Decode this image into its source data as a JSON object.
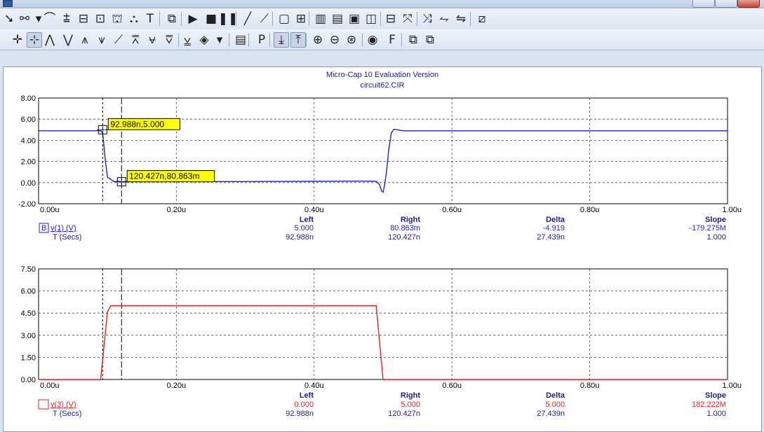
{
  "window": {
    "icons": [
      "app-icon",
      "minimize-icon",
      "maximize-icon",
      "close-icon"
    ]
  },
  "toolbar1": {
    "buttons": [
      {
        "name": "select-mode-icon",
        "glyph": "➘"
      },
      {
        "name": "component-mode-icon",
        "glyph": "⚯"
      },
      {
        "name": "component-dropdown-icon",
        "glyph": "▾"
      },
      {
        "name": "wire-mode-icon",
        "glyph": "⌒"
      },
      {
        "name": "bus-mode-icon",
        "glyph": "⩲"
      },
      {
        "name": "diagonal-wire-icon",
        "glyph": "⊟"
      },
      {
        "name": "flag-mode-icon",
        "glyph": "⊡"
      },
      {
        "name": "pin-mode-icon",
        "glyph": "⛫"
      },
      {
        "name": "info-mode-icon",
        "glyph": "⛬"
      },
      {
        "name": "text-mode-icon",
        "glyph": "T"
      },
      {
        "name": "properties-icon",
        "glyph": "⧉"
      },
      {
        "name": "run-icon",
        "glyph": "▶"
      },
      {
        "name": "stop-icon",
        "glyph": "■"
      },
      {
        "name": "pause-icon",
        "glyph": "❚❚"
      },
      {
        "name": "line-icon",
        "glyph": "╱"
      },
      {
        "name": "arrow-line-icon",
        "glyph": "⟋"
      },
      {
        "name": "rectangle-icon",
        "glyph": "▢"
      },
      {
        "name": "grid-icon",
        "glyph": "⊞"
      },
      {
        "name": "view-1-icon",
        "glyph": "▥"
      },
      {
        "name": "view-2-icon",
        "glyph": "▤"
      },
      {
        "name": "view-3-icon",
        "glyph": "▣"
      },
      {
        "name": "view-4-icon",
        "glyph": "◫"
      },
      {
        "name": "flip-x-icon",
        "glyph": "⊟"
      },
      {
        "name": "flip-y-icon",
        "glyph": "⤧"
      },
      {
        "name": "rotate-icon",
        "glyph": "⤨"
      },
      {
        "name": "mirror-icon",
        "glyph": "⥊"
      },
      {
        "name": "step-icon",
        "glyph": "⇋"
      },
      {
        "name": "plot-icon",
        "glyph": "⧄"
      }
    ]
  },
  "toolbar2": {
    "buttons": [
      {
        "name": "cursor-mode-icon",
        "glyph": "✛"
      },
      {
        "name": "data-cursor-icon",
        "glyph": "⊹"
      },
      {
        "name": "peak-icon",
        "glyph": "⋀"
      },
      {
        "name": "valley-icon",
        "glyph": "⋁"
      },
      {
        "name": "high-icon",
        "glyph": "⩚"
      },
      {
        "name": "low-icon",
        "glyph": "⩛"
      },
      {
        "name": "inflection-icon",
        "glyph": "⟋"
      },
      {
        "name": "global-high-icon",
        "glyph": "⩞"
      },
      {
        "name": "global-low-icon",
        "glyph": "⩝"
      },
      {
        "name": "top-icon",
        "glyph": "⩢"
      },
      {
        "name": "bottom-icon",
        "glyph": "⩣"
      },
      {
        "name": "palette-icon",
        "glyph": "◈"
      },
      {
        "name": "palette-dropdown-icon",
        "glyph": "▾"
      },
      {
        "name": "numeric-output-icon",
        "glyph": "▤"
      },
      {
        "name": "performance-icon",
        "glyph": "P"
      },
      {
        "name": "tag-horizontal-icon",
        "glyph": "⤓"
      },
      {
        "name": "tag-vertical-icon",
        "glyph": "⤒"
      },
      {
        "name": "zoom-in-icon",
        "glyph": "⊕"
      },
      {
        "name": "zoom-out-icon",
        "glyph": "⊖"
      },
      {
        "name": "zoom-fit-icon",
        "glyph": "⊛"
      },
      {
        "name": "animate-icon",
        "glyph": "◉"
      },
      {
        "name": "font-icon",
        "glyph": "F"
      },
      {
        "name": "copy-icon",
        "glyph": "⧉"
      },
      {
        "name": "paste-icon",
        "glyph": "⧉"
      }
    ]
  },
  "chart_data": [
    {
      "type": "line",
      "title": "Micro-Cap 10 Evaluation Version",
      "subtitle": "circuit62.CIR",
      "xlim": [
        0,
        1
      ],
      "x_unit": "u",
      "x_ticks": [
        "0.00u",
        "0.20u",
        "0.40u",
        "0.60u",
        "0.80u",
        "1.00u"
      ],
      "ylim": [
        -2,
        8
      ],
      "y_ticks": [
        "8.00",
        "6.00",
        "4.00",
        "2.00",
        "0.00",
        "-2.00"
      ],
      "grid": true,
      "series": [
        {
          "name": "v(1) (V)",
          "color": "#1f1fe0",
          "x": [
            0.0,
            0.088,
            0.0905,
            0.093,
            0.097,
            0.1,
            0.104,
            0.108,
            0.112,
            0.116,
            0.12,
            0.2,
            0.3,
            0.4,
            0.47,
            0.49,
            0.495,
            0.498,
            0.5,
            0.502,
            0.505,
            0.508,
            0.512,
            0.516,
            0.52,
            0.53,
            0.6,
            0.8,
            1.0
          ],
          "values": [
            4.9,
            4.9,
            4.9,
            4.7,
            2.0,
            0.5,
            0.35,
            0.15,
            0.08,
            0.12,
            0.08,
            0.1,
            0.1,
            0.12,
            0.14,
            0.12,
            -0.2,
            -0.8,
            -0.9,
            -0.3,
            1.0,
            3.0,
            4.7,
            5.05,
            5.0,
            4.9,
            4.9,
            4.9,
            4.9
          ]
        }
      ],
      "markers": [
        {
          "label": "92.988n,5.000",
          "x": 0.092988,
          "y": 5.0
        },
        {
          "label": "120.427n,80.863m",
          "x": 0.120427,
          "y": 0.080863
        }
      ],
      "cursors": {
        "left": 0.092988,
        "right": 0.120427
      },
      "readout": {
        "headers": [
          "Left",
          "Right",
          "Delta",
          "Slope"
        ],
        "rows": [
          {
            "label": "v(1) (V)",
            "badge": "B",
            "values": [
              "5.000",
              "80.863m",
              "-4.919",
              "-179.275M"
            ]
          },
          {
            "label": "T (Secs)",
            "values": [
              "92.988n",
              "120.427n",
              "27.439n",
              "1.000"
            ]
          }
        ]
      }
    },
    {
      "type": "line",
      "xlim": [
        0,
        1
      ],
      "x_unit": "u",
      "x_ticks": [
        "0.00u",
        "0.20u",
        "0.40u",
        "0.60u",
        "0.80u",
        "1.00u"
      ],
      "ylim": [
        0,
        7.5
      ],
      "y_ticks": [
        "7.50",
        "6.00",
        "4.50",
        "3.00",
        "1.50",
        "0.00"
      ],
      "grid": true,
      "series": [
        {
          "name": "v(3) (V)",
          "color": "#ef1c1c",
          "x": [
            0.0,
            0.09,
            0.1,
            0.105,
            0.49,
            0.5,
            1.0
          ],
          "values": [
            0,
            0,
            4.6,
            5.0,
            5.0,
            0,
            0
          ]
        }
      ],
      "cursors": {
        "left": 0.092988,
        "right": 0.120427
      },
      "readout": {
        "headers": [
          "Left",
          "Right",
          "Delta",
          "Slope"
        ],
        "rows": [
          {
            "label": "v(3) (V)",
            "values": [
              "0.000",
              "5.000",
              "5.000",
              "182.222M"
            ]
          },
          {
            "label": "T (Secs)",
            "values": [
              "92.988n",
              "120.427n",
              "27.439n",
              "1.000"
            ]
          }
        ]
      }
    }
  ]
}
